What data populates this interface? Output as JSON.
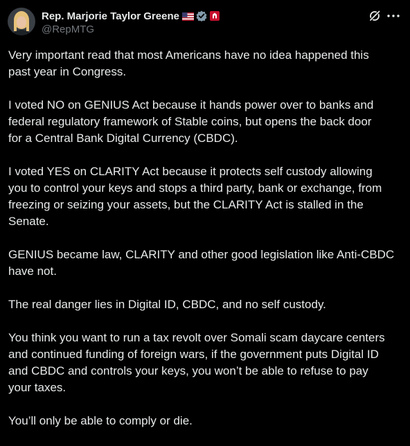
{
  "author": {
    "name": "Rep. Marjorie Taylor Greene",
    "handle": "@RepMTG",
    "flag_icon": "us-flag-icon",
    "verified_icon": "government-verified-badge-icon",
    "affiliation_icon": "house-seal-badge-icon"
  },
  "actions": {
    "grok_icon": "grok-icon",
    "more_icon": "more-options-icon"
  },
  "post": {
    "paragraphs": [
      {
        "lines": [
          "Very important read that most Americans have no idea happened this",
          "past year in Congress."
        ]
      },
      {
        "lines": [
          "I voted NO on GENIUS Act because it hands power over to banks and",
          "federal regulatory framework of Stable coins, but opens the back door",
          "for a Central Bank Digital Currency (CBDC)."
        ]
      },
      {
        "lines": [
          "I voted YES on CLARITY Act because it protects self custody allowing",
          "you to control your keys and stops a third party, bank or exchange, from",
          "freezing or seizing your assets, but the CLARITY Act is stalled in the",
          "Senate."
        ]
      },
      {
        "lines": [
          "GENIUS became law, CLARITY and other good legislation like Anti-CBDC",
          "have not."
        ]
      },
      {
        "lines": [
          "The real danger lies in Digital ID, CBDC, and no self custody."
        ]
      },
      {
        "lines": [
          "You think you want to run a tax revolt over Somali scam daycare centers",
          "and continued funding of foreign wars, if the government puts Digital ID",
          "and CBDC and controls your keys, you won’t be able to refuse to pay",
          "your taxes."
        ]
      },
      {
        "lines": [
          "You’ll only be able to comply or die."
        ]
      }
    ]
  },
  "colors": {
    "background": "#000000",
    "text_primary": "#e7e9ea",
    "text_secondary": "#71767b",
    "verified_grey": "#829aab",
    "seal_red": "#c8102e"
  }
}
